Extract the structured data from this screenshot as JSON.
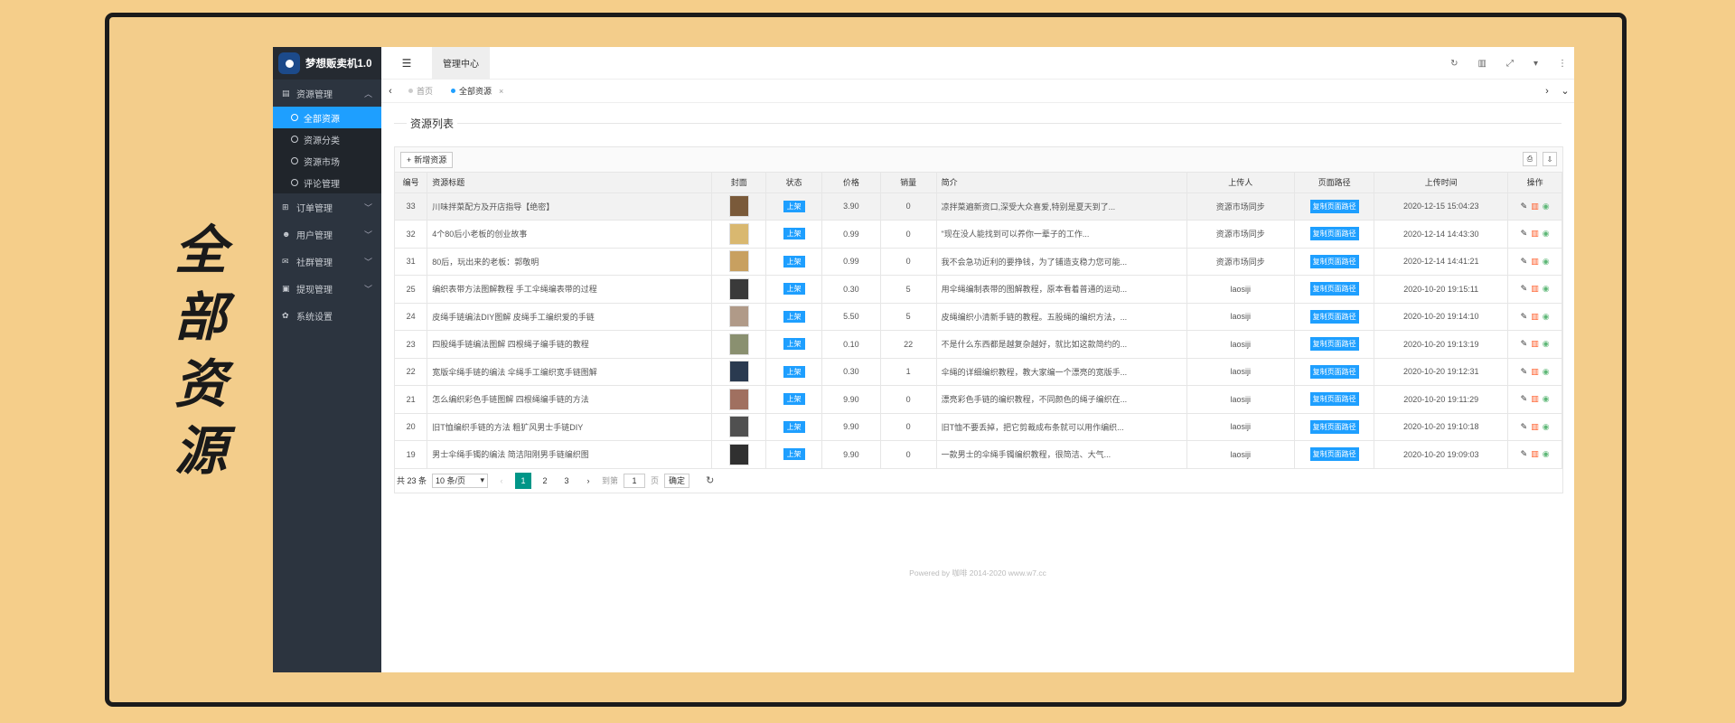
{
  "side_title": [
    "全",
    "部",
    "资",
    "源"
  ],
  "app": {
    "logo_text": "梦想贩卖机1.0",
    "sidebar": {
      "groups": [
        {
          "label": "资源管理",
          "icon": "book-icon",
          "expanded": true
        },
        {
          "label": "订单管理",
          "icon": "cart-icon"
        },
        {
          "label": "用户管理",
          "icon": "users-icon"
        },
        {
          "label": "社群管理",
          "icon": "chat-icon"
        },
        {
          "label": "提现管理",
          "icon": "wallet-icon"
        },
        {
          "label": "系统设置",
          "icon": "gear-icon"
        }
      ],
      "sub_items": [
        {
          "label": "全部资源",
          "active": true
        },
        {
          "label": "资源分类"
        },
        {
          "label": "资源市场"
        },
        {
          "label": "评论管理"
        }
      ]
    },
    "topbar": {
      "tab_label": "管理中心"
    },
    "tabs": [
      {
        "label": "首页",
        "active": false
      },
      {
        "label": "全部资源",
        "active": true
      }
    ],
    "section_title": "资源列表",
    "add_button": "新增资源",
    "table": {
      "headers": [
        "编号",
        "资源标题",
        "封面",
        "状态",
        "价格",
        "销量",
        "简介",
        "上传人",
        "页面路径",
        "上传时间",
        "操作"
      ],
      "status_label": "上架",
      "copy_label": "复制页面路径",
      "rows": [
        {
          "id": "33",
          "title": "川味拌菜配方及开店指导【绝密】",
          "price": "3.90",
          "sales": "0",
          "intro": "凉拌菜遍新资口,深受大众喜爱,特别是夏天到了...",
          "uploader": "资源市场同步",
          "time": "2020-12-15 15:04:23",
          "cover": "#7a5a3a"
        },
        {
          "id": "32",
          "title": "4个80后小老板的创业故事",
          "price": "0.99",
          "sales": "0",
          "intro": "\"现在没人能找到可以养你一辈子的工作...",
          "uploader": "资源市场同步",
          "time": "2020-12-14 14:43:30",
          "cover": "#d9b870"
        },
        {
          "id": "31",
          "title": "80后，玩出来的老板：郭敬明",
          "price": "0.99",
          "sales": "0",
          "intro": "我不会急功近利的要挣钱，为了铺造支稳力您可能...",
          "uploader": "资源市场同步",
          "time": "2020-12-14 14:41:21",
          "cover": "#c8a060"
        },
        {
          "id": "25",
          "title": "编织表带方法图解教程 手工伞绳编表带的过程",
          "price": "0.30",
          "sales": "5",
          "intro": "用伞绳编制表带的图解教程，原本看着普通的运动...",
          "uploader": "laosiji",
          "time": "2020-10-20 19:15:11",
          "cover": "#3a3a3a"
        },
        {
          "id": "24",
          "title": "皮绳手链编法DIY图解 皮绳手工编织爱的手链",
          "price": "5.50",
          "sales": "5",
          "intro": "皮绳编织小清新手链的教程。五股绳的编织方法，...",
          "uploader": "laosiji",
          "time": "2020-10-20 19:14:10",
          "cover": "#b09a88"
        },
        {
          "id": "23",
          "title": "四股绳手链编法图解 四根绳子编手链的教程",
          "price": "0.10",
          "sales": "22",
          "intro": "不是什么东西都是越复杂越好，就比如这款简约的...",
          "uploader": "laosiji",
          "time": "2020-10-20 19:13:19",
          "cover": "#8a9070"
        },
        {
          "id": "22",
          "title": "宽版伞绳手链的编法 伞绳手工编织宽手链图解",
          "price": "0.30",
          "sales": "1",
          "intro": "伞绳的详细编织教程，教大家编一个漂亮的宽版手...",
          "uploader": "laosiji",
          "time": "2020-10-20 19:12:31",
          "cover": "#2a3a50"
        },
        {
          "id": "21",
          "title": "怎么编织彩色手链图解 四根绳编手链的方法",
          "price": "9.90",
          "sales": "0",
          "intro": "漂亮彩色手链的编织教程，不同颜色的绳子编织在...",
          "uploader": "laosiji",
          "time": "2020-10-20 19:11:29",
          "cover": "#a07060"
        },
        {
          "id": "20",
          "title": "旧T恤编织手链的方法 粗犷风男士手链DIY",
          "price": "9.90",
          "sales": "0",
          "intro": "旧T恤不要丢掉，把它剪裁成布条就可以用作编织...",
          "uploader": "laosiji",
          "time": "2020-10-20 19:10:18",
          "cover": "#505050"
        },
        {
          "id": "19",
          "title": "男士伞绳手镯的编法 简洁阳刚男手链编织图",
          "price": "9.90",
          "sales": "0",
          "intro": "一款男士的伞绳手镯编织教程，很简洁、大气...",
          "uploader": "laosiji",
          "time": "2020-10-20 19:09:03",
          "cover": "#303030"
        }
      ]
    },
    "pager": {
      "total": "共 23 条",
      "per_page": "10 条/页",
      "pages": [
        "1",
        "2",
        "3"
      ],
      "current": "1",
      "goto_label": "到第",
      "goto_value": "1",
      "page_unit": "页",
      "confirm": "确定"
    },
    "footer": "Powered by 咖啡 2014-2020 www.w7.cc"
  }
}
